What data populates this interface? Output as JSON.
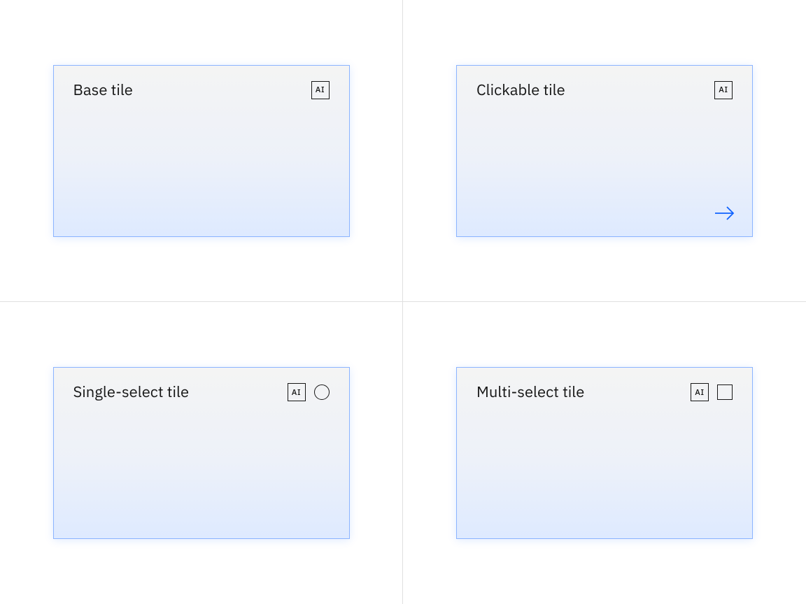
{
  "tiles": [
    {
      "title": "Base tile",
      "ai_label": "AI"
    },
    {
      "title": "Clickable tile",
      "ai_label": "AI"
    },
    {
      "title": "Single-select tile",
      "ai_label": "AI"
    },
    {
      "title": "Multi-select tile",
      "ai_label": "AI"
    }
  ]
}
